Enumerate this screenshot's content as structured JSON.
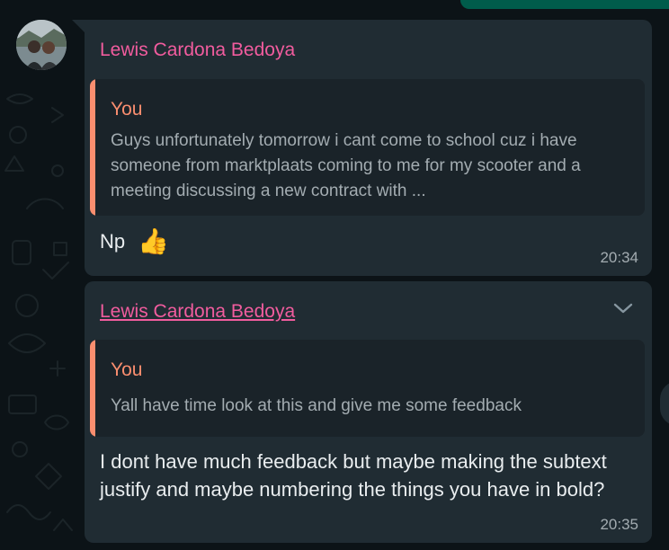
{
  "chat": {
    "messages": [
      {
        "sender": "Lewis Cardona Bedoya",
        "quoted": {
          "author": "You",
          "text": "Guys unfortunately tomorrow i cant come to school cuz i have someone from marktplaats coming to me for my scooter and a meeting discussing a new contract with ..."
        },
        "text": "Np",
        "emoji": "👍",
        "time": "20:34"
      },
      {
        "sender": "Lewis Cardona Bedoya",
        "quoted": {
          "author": "You",
          "text": "Yall have time look at this and give me some feedback"
        },
        "text": "I dont have much feedback but maybe making the subtext justify and maybe numbering the things you have in bold?",
        "time": "20:35"
      }
    ]
  },
  "colors": {
    "background": "#0c1317",
    "bubble_incoming": "#202c33",
    "quote_background": "#1a2329",
    "sender_name": "#f15c9e",
    "quote_accent": "#fa8e6f",
    "text_primary": "#e9edef",
    "text_secondary": "#a3acb1",
    "outgoing_bubble": "#005c4b"
  },
  "icons": {
    "message_menu": "chevron-down-icon",
    "reaction_emoji": "thumbs-up-emoji"
  }
}
